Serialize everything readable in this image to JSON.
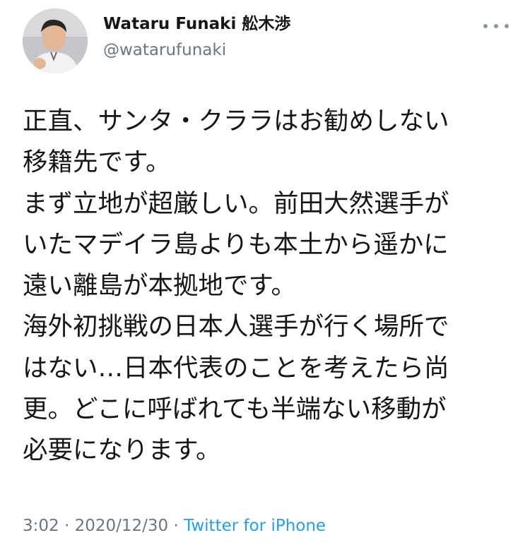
{
  "tweet": {
    "author": {
      "display_name": "Wataru Funaki 舩木渉",
      "handle": "@watarufunaki",
      "avatar_icon": "user-avatar-photo"
    },
    "more_icon": "more-horizontal-icon",
    "text_lines": [
      "正直、サンタ・クララはお勧めしない",
      "移籍先です。",
      "まず立地が超厳しい。前田大然選手が",
      "いたマデイラ島よりも本土から遥かに",
      "遠い離島が本拠地です。",
      "海外初挑戦の日本人選手が行く場所で",
      "はない…日本代表のことを考えたら尚",
      "更。どこに呼ばれても半端ない移動が",
      "必要になります。"
    ],
    "time": "3:02",
    "separator": " · ",
    "date": "2020/12/30",
    "source": "Twitter for iPhone"
  },
  "colors": {
    "text": "#14171a",
    "secondary": "#657786",
    "link": "#1da1f2",
    "icon": "#8899a6"
  }
}
